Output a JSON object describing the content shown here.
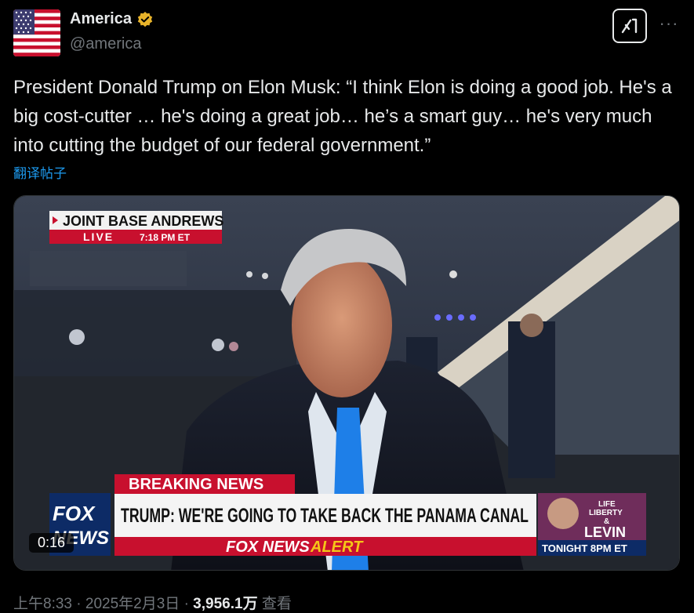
{
  "account": {
    "name": "America",
    "handle": "@america",
    "verified_badge_color": "#e8b32a",
    "avatar_icon": "us-flag-icon"
  },
  "header": {
    "grok_icon": "grok-icon",
    "more_label": "···"
  },
  "post": {
    "text": "President Donald Trump on Elon Musk: “I think Elon is doing a good job. He's a big cost-cutter … he's doing a great job… he’s a smart guy… he's very much into cutting the budget of our federal government.”",
    "translate_label": "翻译帖子"
  },
  "media": {
    "duration": "0:16",
    "location_bug": "JOINT BASE ANDREWS",
    "live_label": "LIVE",
    "live_time": "7:18 PM ET",
    "breaking_label": "BREAKING NEWS",
    "headline": "TRUMP: WE'RE GOING TO TAKE BACK THE PANAMA CANAL",
    "alert_prefix": "FOX NEWS",
    "alert_word": "ALERT",
    "fox_logo_top": "FOX",
    "fox_logo_bottom": "NEWS",
    "promo_line1": "LIFE",
    "promo_line2": "LIBERTY",
    "promo_amp": "&",
    "promo_line3": "LEVIN",
    "promo_time": "TONIGHT 8PM ET"
  },
  "meta": {
    "time": "上午8:33",
    "date": "2025年2月3日",
    "views": "3,956.1万",
    "views_label": "查看",
    "separator": "·"
  }
}
